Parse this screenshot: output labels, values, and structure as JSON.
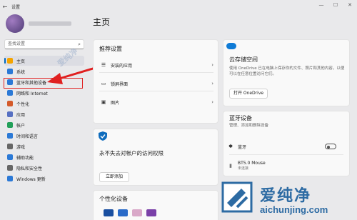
{
  "titlebar": {
    "back": "←",
    "title": "设置",
    "min": "—",
    "max": "☐",
    "close": "✕"
  },
  "search": {
    "placeholder": "查找设置"
  },
  "nav": [
    {
      "label": "主页",
      "color": "#f4a400"
    },
    {
      "label": "系统",
      "color": "#2b79d6"
    },
    {
      "label": "蓝牙和其他设备",
      "color": "#2b79d6"
    },
    {
      "label": "网络和 Internet",
      "color": "#2b79d6"
    },
    {
      "label": "个性化",
      "color": "#d45a2a"
    },
    {
      "label": "应用",
      "color": "#5770c2"
    },
    {
      "label": "帐户",
      "color": "#23a05a"
    },
    {
      "label": "时间和语言",
      "color": "#2b79d6"
    },
    {
      "label": "游戏",
      "color": "#666666"
    },
    {
      "label": "辅助功能",
      "color": "#2b79d6"
    },
    {
      "label": "隐私和安全性",
      "color": "#666666"
    },
    {
      "label": "Windows 更新",
      "color": "#2b79d6"
    }
  ],
  "page_title": "主页",
  "recommended": {
    "title": "推荐设置",
    "items": [
      {
        "icon": "☰",
        "label": "安装的应用"
      },
      {
        "icon": "▭",
        "label": "锁屏界面"
      },
      {
        "icon": "▣",
        "label": "图片"
      }
    ]
  },
  "access": {
    "title": "永不失去对帐户的访问权限",
    "button": "立即添加"
  },
  "personalize": {
    "title": "个性化设备"
  },
  "cloud": {
    "title": "云存储空间",
    "desc": "使用 OneDrive 已在电脑上保存你的文件、照片和其他内容，以便可以在任意位置访问它们。",
    "button": "打开 OneDrive"
  },
  "bluetooth": {
    "title": "蓝牙设备",
    "desc": "管理、添加和删除设备",
    "items": [
      {
        "icon": "✱",
        "label": "蓝牙",
        "sub": ""
      },
      {
        "icon": "▮",
        "label": "BT5.0 Mouse",
        "sub": "未连接"
      }
    ]
  },
  "watermark": {
    "text": "爱纯净",
    "url": "aichunjing.com",
    "mid": "爱纯净"
  },
  "colors": {
    "accent": "#0067c0",
    "highlight": "#e02020"
  }
}
